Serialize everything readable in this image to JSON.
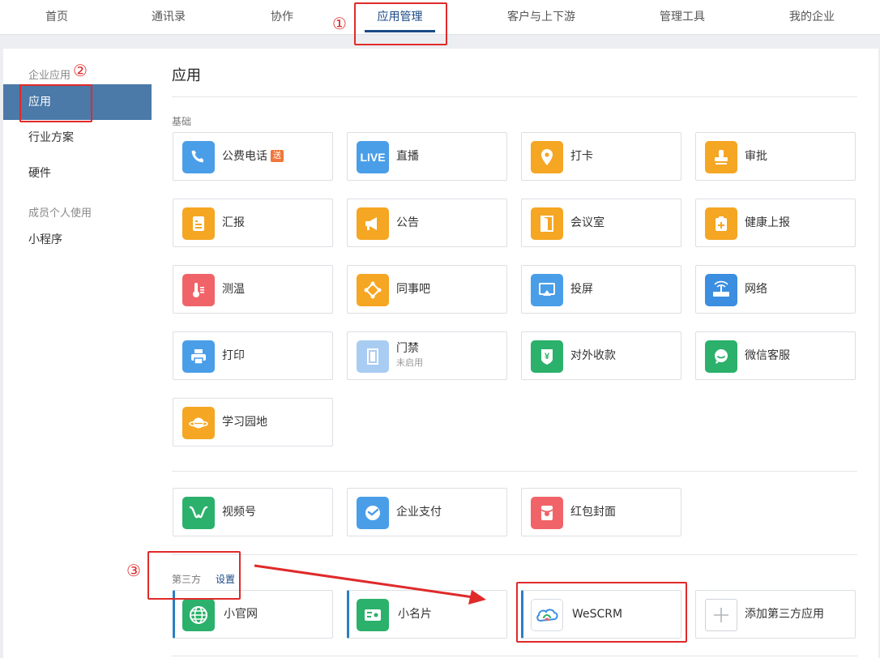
{
  "topnav": {
    "tabs": [
      "首页",
      "通讯录",
      "协作",
      "应用管理",
      "客户与上下游",
      "管理工具",
      "我的企业"
    ]
  },
  "sidebar": {
    "sec_enterprise": "企业应用",
    "items": [
      "应用",
      "行业方案",
      "硬件"
    ],
    "sec_personal": "成员个人使用",
    "mini_program": "小程序"
  },
  "main": {
    "title": "应用",
    "group_basic": "基础",
    "group_third": "第三方",
    "settings": "设置",
    "badge_gift": "送",
    "disabled_sub": "未启用",
    "apps": [
      {
        "label": "公费电话",
        "icon": "phone-icon",
        "color": "#4a9ee8"
      },
      {
        "label": "直播",
        "icon": "live-icon",
        "color": "#4a9ee8"
      },
      {
        "label": "打卡",
        "icon": "location-pin-icon",
        "color": "#f5a623"
      },
      {
        "label": "审批",
        "icon": "stamp-icon",
        "color": "#f5a623"
      },
      {
        "label": "汇报",
        "icon": "report-icon",
        "color": "#f5a623"
      },
      {
        "label": "公告",
        "icon": "megaphone-icon",
        "color": "#f5a623"
      },
      {
        "label": "会议室",
        "icon": "door-icon",
        "color": "#f5a623"
      },
      {
        "label": "健康上报",
        "icon": "health-kit-icon",
        "color": "#f5a623"
      },
      {
        "label": "测温",
        "icon": "thermometer-icon",
        "color": "#f06469"
      },
      {
        "label": "同事吧",
        "icon": "network-icon",
        "color": "#f5a623"
      },
      {
        "label": "投屏",
        "icon": "screen-cast-icon",
        "color": "#4a9ee8"
      },
      {
        "label": "网络",
        "icon": "router-icon",
        "color": "#3b8ee0"
      },
      {
        "label": "打印",
        "icon": "printer-icon",
        "color": "#4a9ee8"
      },
      {
        "label": "门禁",
        "icon": "door-access-icon",
        "color": "#a9cdf2"
      },
      {
        "label": "对外收款",
        "icon": "yuan-shield-icon",
        "color": "#2bb16b"
      },
      {
        "label": "微信客服",
        "icon": "chat-bubble-icon",
        "color": "#2bb16b"
      },
      {
        "label": "学习园地",
        "icon": "planet-icon",
        "color": "#f5a623"
      },
      {
        "label": "视频号",
        "icon": "channels-icon",
        "color": "#2bb16b"
      },
      {
        "label": "企业支付",
        "icon": "pay-check-icon",
        "color": "#4a9ee8"
      },
      {
        "label": "红包封面",
        "icon": "red-envelope-icon",
        "color": "#f06469"
      },
      {
        "label": "小官网",
        "icon": "globe-icon",
        "color": "#2bb16b"
      },
      {
        "label": "小名片",
        "icon": "card-icon",
        "color": "#2bb16b"
      },
      {
        "label": "WeSCRM",
        "icon": "wescrm-logo-icon",
        "color": "#ffffff"
      },
      {
        "label": "添加第三方应用",
        "icon": "plus-icon",
        "color": "#ffffff"
      }
    ]
  },
  "annotations": [
    "①",
    "②",
    "③"
  ]
}
